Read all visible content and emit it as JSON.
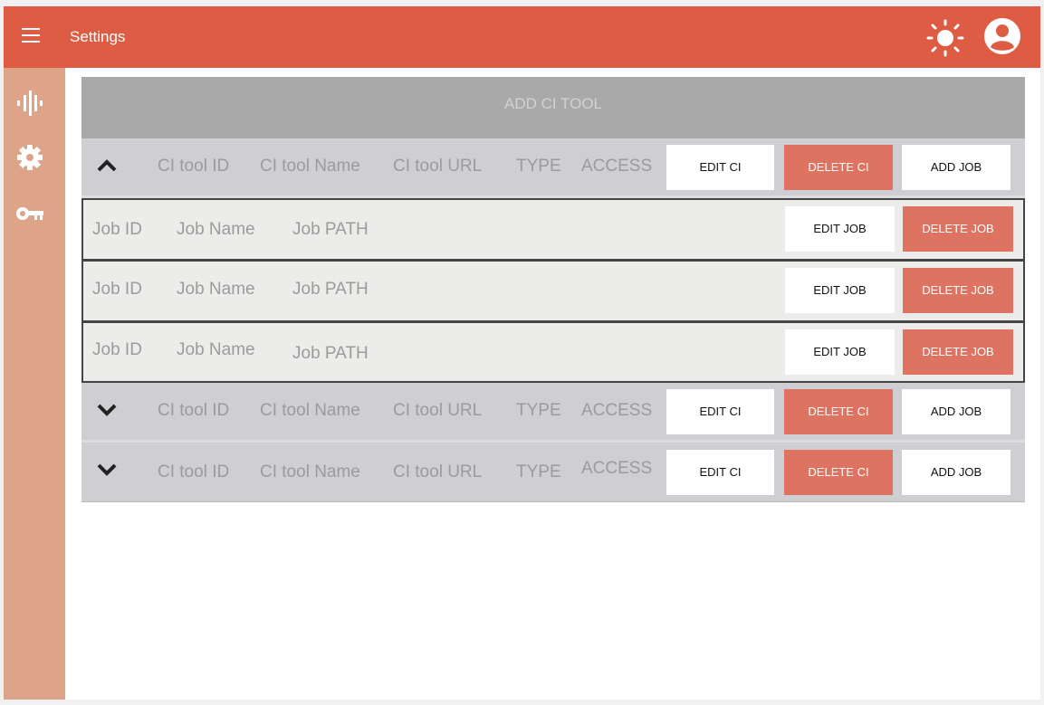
{
  "header": {
    "title": "Settings",
    "accent_color": "#dd5c43"
  },
  "sidebar": {
    "background_color": "#dda48a",
    "items": [
      {
        "name": "audio-wave-icon"
      },
      {
        "name": "gear-icon"
      },
      {
        "name": "key-icon"
      }
    ]
  },
  "main": {
    "add_ci_label": "ADD CI TOOL",
    "ci_rows": [
      {
        "expanded": true,
        "id": "CI tool ID",
        "name": "CI tool Name",
        "url": "CI tool URL",
        "type": "TYPE",
        "access": "ACCESS",
        "edit_label": "EDIT CI",
        "delete_label": "DELETE CI",
        "add_job_label": "ADD JOB",
        "jobs": [
          {
            "id": "Job ID",
            "name": "Job Name",
            "path": "Job PATH",
            "edit_label": "EDIT JOB",
            "delete_label": "DELETE JOB"
          },
          {
            "id": "Job ID",
            "name": "Job Name",
            "path": "Job PATH",
            "edit_label": "EDIT JOB",
            "delete_label": "DELETE JOB"
          },
          {
            "id": "Job ID",
            "name": "Job Name",
            "path": "Job PATH",
            "edit_label": "EDIT JOB",
            "delete_label": "DELETE JOB"
          }
        ]
      },
      {
        "expanded": false,
        "id": "CI tool ID",
        "name": "CI tool Name",
        "url": "CI tool URL",
        "type": "TYPE",
        "access": "ACCESS",
        "edit_label": "EDIT CI",
        "delete_label": "DELETE CI",
        "add_job_label": "ADD JOB"
      },
      {
        "expanded": false,
        "id": "CI tool ID",
        "name": "CI tool Name",
        "url": "CI tool URL",
        "type": "TYPE",
        "access": "ACCESS",
        "edit_label": "EDIT CI",
        "delete_label": "DELETE CI",
        "add_job_label": "ADD JOB"
      }
    ]
  }
}
